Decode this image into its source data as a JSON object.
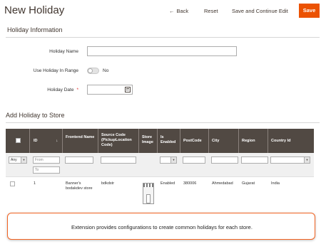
{
  "header": {
    "title": "New Holiday",
    "back_label": "Back",
    "back_icon": "left-arrow-icon",
    "reset_label": "Reset",
    "save_continue_label": "Save and Continue Edit",
    "save_label": "Save",
    "accent_color": "#eb5202"
  },
  "holiday_info": {
    "section_title": "Holiday Information",
    "name_label": "Holiday Name",
    "name_value": "",
    "range_label": "Use Holiday In Range",
    "range_toggle_state": "No",
    "date_label": "Holiday Date",
    "required_mark": "*",
    "date_value": "",
    "calendar_icon": "calendar-icon"
  },
  "grid": {
    "section_title": "Add Holiday to Store",
    "columns": {
      "id": "ID",
      "sort_arrow": "↓",
      "frontend_name": "Frontend Name",
      "source_code": "Source Code (PickupLocation Code)",
      "store_image": "Store Image",
      "is_enabled": "Is Enabled",
      "postcode": "PostCode",
      "city": "City",
      "region": "Region",
      "country": "Country Id"
    },
    "header_bg": "#514943",
    "filters": {
      "any_select": "Any",
      "from_placeholder": "From",
      "to_placeholder": "To"
    },
    "rows": [
      {
        "id": "1",
        "frontend_name": "Banner's bodakdev store",
        "source_code": "bdkdstr",
        "is_enabled": "Enabled",
        "postcode": "380006",
        "city": "Ahmedabad",
        "region": "Gujarat",
        "country": "India"
      }
    ]
  },
  "callout": {
    "text": "Extension provides configurations to create common holidays for each store.",
    "border_color": "#f26322"
  }
}
